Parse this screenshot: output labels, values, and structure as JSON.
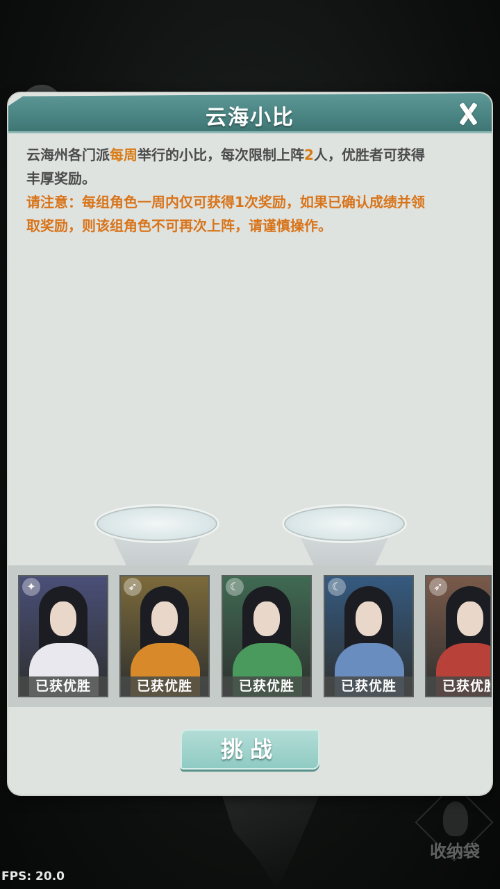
{
  "panel": {
    "title": "云海小比",
    "desc_line1_a": "云海州各门派",
    "desc_line1_hl1": "每周",
    "desc_line1_b": "举行的小比，每次限制上阵",
    "desc_line1_hl2": "2",
    "desc_line1_c": "人，优胜者可获得",
    "desc_line2": "丰厚奖励。",
    "notice_line1": "请注意：每组角色一周内仅可获得1次奖励，如果已确认成绩并领",
    "notice_line2": "取奖励，则该组角色不可再次上阵，请谨慎操作。"
  },
  "characters": [
    {
      "badge": "已获优胜",
      "emblem": "sword-emblem-icon",
      "bg": "#4a4f78",
      "robe": "#e8e8ee"
    },
    {
      "badge": "已获优胜",
      "emblem": "blade-emblem-icon",
      "bg": "#7c6a3a",
      "robe": "#d88a2a"
    },
    {
      "badge": "已获优胜",
      "emblem": "moon-emblem-icon",
      "bg": "#3f6a52",
      "robe": "#4a9a5e"
    },
    {
      "badge": "已获优胜",
      "emblem": "moon-emblem-icon",
      "bg": "#355a80",
      "robe": "#6a8dbf"
    },
    {
      "badge": "已获优胜",
      "emblem": "blade-emblem-icon",
      "bg": "#7a5a4a",
      "robe": "#b8413a"
    }
  ],
  "challenge_label": "挑战",
  "storage_bag_label": "收纳袋",
  "fps_label": "FPS: 20.0",
  "colors": {
    "header": "#4b8684",
    "highlight": "#d87a14",
    "panel_bg": "#dfe3e0",
    "button": "#8ecac2"
  }
}
